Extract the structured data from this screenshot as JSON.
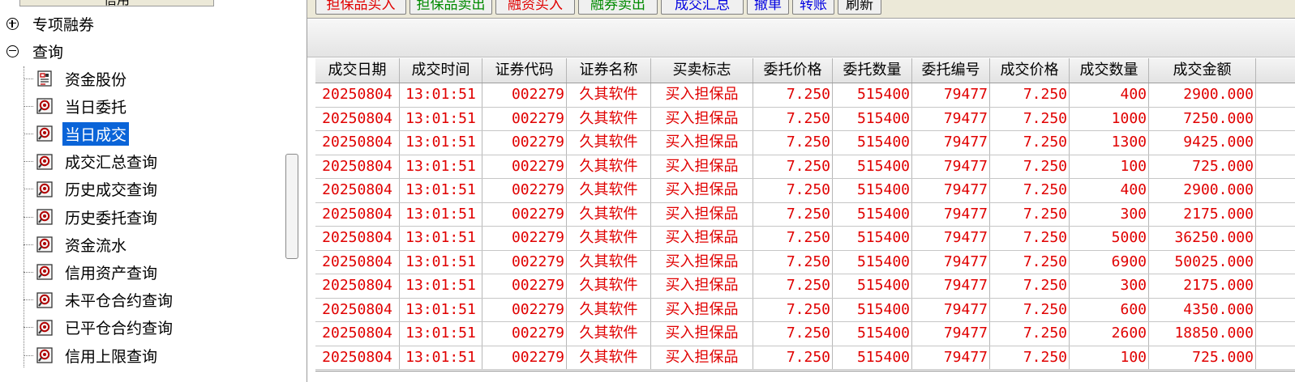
{
  "tree": {
    "top_tab_label": "信用",
    "nodes": [
      {
        "label": "专项融券",
        "expander": "plus"
      },
      {
        "label": "查询",
        "expander": "minus"
      }
    ],
    "children": [
      {
        "label": "资金股份",
        "icon": "money-stock-icon"
      },
      {
        "label": "当日委托",
        "icon": "query-icon"
      },
      {
        "label": "当日成交",
        "icon": "query-icon",
        "selected": true
      },
      {
        "label": "成交汇总查询",
        "icon": "query-icon"
      },
      {
        "label": "历史成交查询",
        "icon": "query-icon"
      },
      {
        "label": "历史委托查询",
        "icon": "query-icon"
      },
      {
        "label": "资金流水",
        "icon": "query-icon"
      },
      {
        "label": "信用资产查询",
        "icon": "query-icon"
      },
      {
        "label": "未平仓合约查询",
        "icon": "query-icon"
      },
      {
        "label": "已平仓合约查询",
        "icon": "query-icon"
      },
      {
        "label": "信用上限查询",
        "icon": "query-icon"
      }
    ],
    "selection_color": "#0a64d8"
  },
  "toolbar": {
    "buttons": [
      {
        "label": "担保品买入",
        "color": "#e00000"
      },
      {
        "label": "担保品卖出",
        "color": "#008a00"
      },
      {
        "label": "融资买入",
        "color": "#e00000"
      },
      {
        "label": "融券卖出",
        "color": "#008a00"
      },
      {
        "label": "成交汇总",
        "color": "#0000e0"
      },
      {
        "label": "撤单",
        "color": "#0000e0"
      },
      {
        "label": "转账",
        "color": "#0000e0"
      },
      {
        "label": "刷新",
        "color": "#000000"
      }
    ]
  },
  "grid": {
    "text_color": "#e00000",
    "columns": [
      "成交日期",
      "成交时间",
      "证券代码",
      "证券名称",
      "买卖标志",
      "委托价格",
      "委托数量",
      "委托编号",
      "成交价格",
      "成交数量",
      "成交金额"
    ],
    "rows": [
      [
        "20250804",
        "13:01:51",
        "002279",
        "久其软件",
        "买入担保品",
        "7.250",
        "515400",
        "79477",
        "7.250",
        "400",
        "2900.000"
      ],
      [
        "20250804",
        "13:01:51",
        "002279",
        "久其软件",
        "买入担保品",
        "7.250",
        "515400",
        "79477",
        "7.250",
        "1000",
        "7250.000"
      ],
      [
        "20250804",
        "13:01:51",
        "002279",
        "久其软件",
        "买入担保品",
        "7.250",
        "515400",
        "79477",
        "7.250",
        "1300",
        "9425.000"
      ],
      [
        "20250804",
        "13:01:51",
        "002279",
        "久其软件",
        "买入担保品",
        "7.250",
        "515400",
        "79477",
        "7.250",
        "100",
        "725.000"
      ],
      [
        "20250804",
        "13:01:51",
        "002279",
        "久其软件",
        "买入担保品",
        "7.250",
        "515400",
        "79477",
        "7.250",
        "400",
        "2900.000"
      ],
      [
        "20250804",
        "13:01:51",
        "002279",
        "久其软件",
        "买入担保品",
        "7.250",
        "515400",
        "79477",
        "7.250",
        "300",
        "2175.000"
      ],
      [
        "20250804",
        "13:01:51",
        "002279",
        "久其软件",
        "买入担保品",
        "7.250",
        "515400",
        "79477",
        "7.250",
        "5000",
        "36250.000"
      ],
      [
        "20250804",
        "13:01:51",
        "002279",
        "久其软件",
        "买入担保品",
        "7.250",
        "515400",
        "79477",
        "7.250",
        "6900",
        "50025.000"
      ],
      [
        "20250804",
        "13:01:51",
        "002279",
        "久其软件",
        "买入担保品",
        "7.250",
        "515400",
        "79477",
        "7.250",
        "300",
        "2175.000"
      ],
      [
        "20250804",
        "13:01:51",
        "002279",
        "久其软件",
        "买入担保品",
        "7.250",
        "515400",
        "79477",
        "7.250",
        "600",
        "4350.000"
      ],
      [
        "20250804",
        "13:01:51",
        "002279",
        "久其软件",
        "买入担保品",
        "7.250",
        "515400",
        "79477",
        "7.250",
        "2600",
        "18850.000"
      ],
      [
        "20250804",
        "13:01:51",
        "002279",
        "久其软件",
        "买入担保品",
        "7.250",
        "515400",
        "79477",
        "7.250",
        "100",
        "725.000"
      ]
    ]
  }
}
